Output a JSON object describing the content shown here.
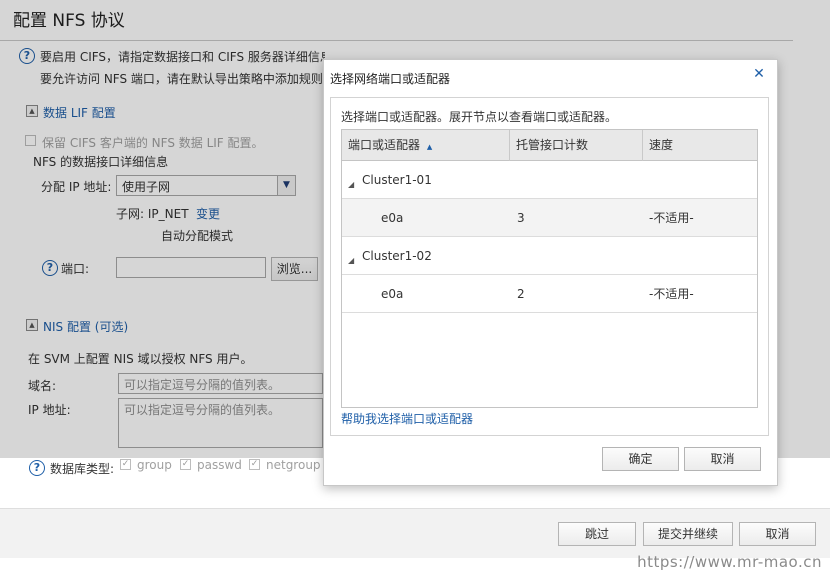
{
  "page": {
    "title": "配置 NFS 协议",
    "info_line1": "要启用 CIFS，请指定数据接口和 CIFS 服务器详细信息。如果正在配置 NFS，请指定 NIS 详细信息。",
    "info_line2": "要允许访问 NFS 端口，请在默认导出策略中添加规则"
  },
  "lif": {
    "section_title": "数据 LIF 配置",
    "retain_label": "保留 CIFS 客户端的 NFS 数据 LIF 配置。",
    "details_label": "NFS 的数据接口详细信息",
    "assign_ip_label": "分配 IP 地址:",
    "assign_ip_value": "使用子网",
    "subnet_label": "子网: IP_NET",
    "change_link": "变更",
    "auto_mode": "自动分配模式",
    "port_label": "端口:",
    "browse_button": "浏览..."
  },
  "nis": {
    "section_title": "NIS 配置 (可选)",
    "desc": "在 SVM 上配置 NIS 域以授权 NFS 用户。",
    "domain_label": "域名:",
    "domain_placeholder": "可以指定逗号分隔的值列表。",
    "ip_label": "IP 地址:",
    "ip_placeholder": "可以指定逗号分隔的值列表。",
    "db_type_label": "数据库类型:",
    "db_types": [
      "group",
      "passwd",
      "netgroup"
    ]
  },
  "footer": {
    "skip": "跳过",
    "submit": "提交并继续",
    "cancel": "取消"
  },
  "dialog": {
    "title": "选择网络端口或适配器",
    "instruction": "选择端口或适配器。展开节点以查看端口或适配器。",
    "columns": [
      "端口或适配器",
      "托管接口计数",
      "速度"
    ],
    "nodes": [
      {
        "name": "Cluster1-01",
        "ports": [
          {
            "port": "e0a",
            "count": "3",
            "speed": "-不适用-"
          }
        ]
      },
      {
        "name": "Cluster1-02",
        "ports": [
          {
            "port": "e0a",
            "count": "2",
            "speed": "-不适用-"
          }
        ]
      }
    ],
    "help_link": "帮助我选择端口或适配器",
    "ok": "确定",
    "cancel": "取消"
  },
  "watermark": "https://www.mr-mao.cn",
  "icons": {
    "help": "question-circle-icon",
    "collapse": "collapse-triangle-icon",
    "sort": "sort-ascending-icon",
    "tree_expanded": "tree-expanded-icon",
    "close": "close-icon",
    "dropdown": "chevron-down-icon",
    "check": "checkmark-icon"
  },
  "colors": {
    "link": "#1f5fa8",
    "overlay": "rgba(0,0,0,0.16)"
  }
}
